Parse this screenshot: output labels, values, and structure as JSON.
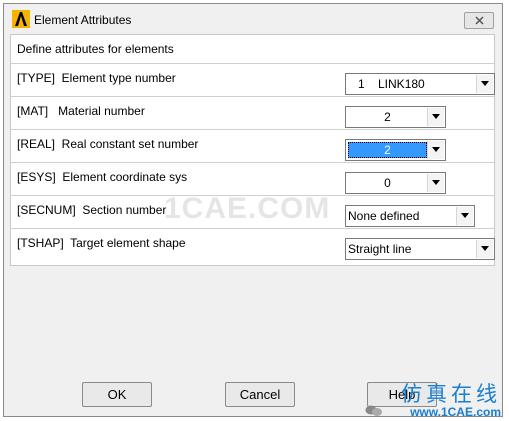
{
  "window": {
    "title": "Element Attributes"
  },
  "header": {
    "label": "Define attributes for elements"
  },
  "rows": [
    {
      "label": "[TYPE]  Element type number",
      "value": "1    LINK180"
    },
    {
      "label": "[MAT]   Material number",
      "value": "2"
    },
    {
      "label": "[REAL]  Real constant set number",
      "value": "2"
    },
    {
      "label": "[ESYS]  Element coordinate sys",
      "value": "0"
    },
    {
      "label": "[SECNUM]  Section number",
      "value": "None defined"
    },
    {
      "label": "[TSHAP]  Target element shape",
      "value": "Straight line"
    }
  ],
  "buttons": {
    "ok": "OK",
    "cancel": "Cancel",
    "help": "Help"
  },
  "watermark": "1CAE.COM",
  "brand": {
    "chinese": "仿真在线",
    "url": "www.1CAE.com"
  },
  "colors": {
    "selection": "#3399ff",
    "brand": "#1a7fd1",
    "logo": "#f5b400"
  },
  "icons": {
    "logo": "ansys-logo-icon",
    "close": "close-icon",
    "dropdown": "chevron-down-icon"
  }
}
